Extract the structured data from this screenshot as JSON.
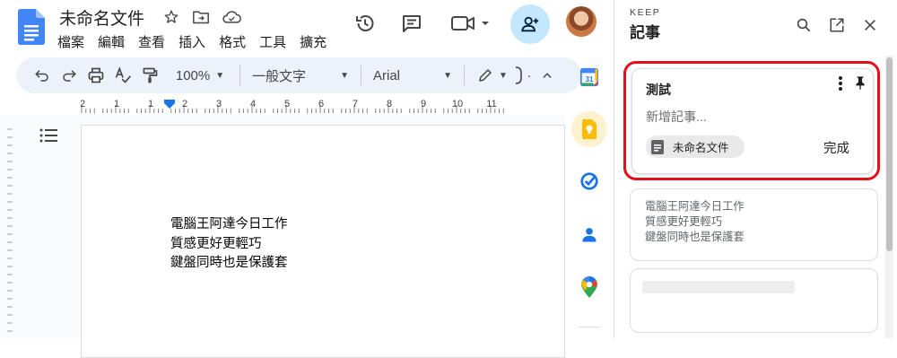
{
  "docs": {
    "title": "未命名文件",
    "menu": [
      "檔案",
      "編輯",
      "查看",
      "插入",
      "格式",
      "工具",
      "擴充"
    ]
  },
  "toolbar": {
    "zoom": "100%",
    "style": "一般文字",
    "font": "Arial"
  },
  "ruler": {
    "labels": [
      "2",
      "1",
      "1",
      "2",
      "3",
      "4",
      "5",
      "6",
      "7",
      "8",
      "9",
      "10",
      "11"
    ]
  },
  "document": {
    "lines": [
      "電腦王阿達今日工作",
      "質感更好更輕巧",
      "鍵盤同時也是保護套"
    ]
  },
  "keep": {
    "brand": "KEEP",
    "title": "記事",
    "editing_note": {
      "title": "測試",
      "placeholder": "新增記事...",
      "linked_doc": "未命名文件",
      "done_label": "完成"
    },
    "notes": [
      {
        "lines": [
          "電腦王阿達今日工作",
          "質感更好更輕巧",
          "鍵盤同時也是保護套"
        ]
      }
    ]
  },
  "colors": {
    "accent_blue": "#1a73e8",
    "share_bg": "#c2e7ff",
    "toolbar_bg": "#edf2fa",
    "highlight_red": "#e3101b",
    "keep_yellow": "#fbbc04"
  }
}
